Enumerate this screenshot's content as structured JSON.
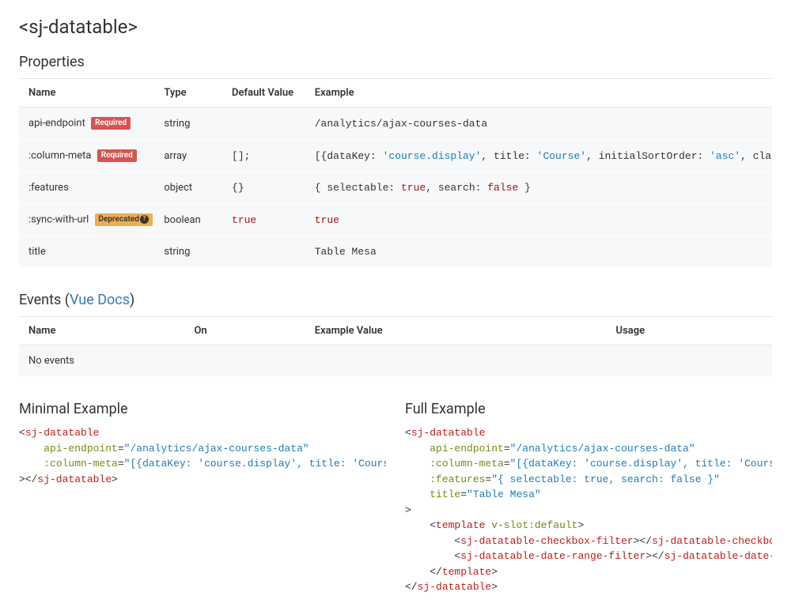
{
  "page_title": "<sj-datatable>",
  "props_section": {
    "title": "Properties",
    "headers": {
      "name": "Name",
      "type": "Type",
      "default": "Default Value",
      "example": "Example"
    },
    "rows": [
      {
        "name": "api-endpoint",
        "required": true,
        "deprecated": false,
        "type": "string",
        "default": "",
        "example": "/analytics/ajax-courses-data"
      },
      {
        "name": ":column-meta",
        "required": true,
        "deprecated": false,
        "type": "array",
        "default": "[];",
        "example": "[{dataKey: 'course.display', title: 'Course', initialSortOrder: 'asc', class: 'text-left', isSortable: true}]"
      },
      {
        "name": ":features",
        "required": false,
        "deprecated": false,
        "type": "object",
        "default": "{}",
        "example": "{ selectable: true, search: false }"
      },
      {
        "name": ":sync-with-url",
        "required": false,
        "deprecated": true,
        "type": "boolean",
        "default": "true",
        "example": "true"
      },
      {
        "name": "title",
        "required": false,
        "deprecated": false,
        "type": "string",
        "default": "",
        "example": "Table Mesa"
      }
    ]
  },
  "badges": {
    "required": "Required",
    "deprecated": "Deprecated"
  },
  "events_section": {
    "title_prefix": "Events (",
    "link_label": "Vue Docs",
    "title_suffix": ")",
    "headers": {
      "name": "Name",
      "on": "On",
      "example": "Example Value",
      "usage": "Usage"
    },
    "empty": "No events"
  },
  "examples": {
    "minimal": {
      "title": "Minimal Example",
      "tag": "sj-datatable",
      "attrs": {
        "api_endpoint": {
          "name": "api-endpoint",
          "value": "/analytics/ajax-courses-data"
        },
        "column_meta": {
          "name": ":column-meta",
          "value": "[{dataKey: 'course.display', title: 'Course', initialSortOrder: 'asc', class: 'text-left', isSortable: true}]"
        }
      }
    },
    "full": {
      "title": "Full Example",
      "tag": "sj-datatable",
      "attrs": {
        "api_endpoint": {
          "name": "api-endpoint",
          "value": "/analytics/ajax-courses-data"
        },
        "column_meta": {
          "name": ":column-meta",
          "value": "[{dataKey: 'course.display', title: 'Course', initialSortOrder: 'asc', class: 'text-left', isSortable: true}]"
        },
        "features": {
          "name": ":features",
          "value": "{ selectable: true, search: false }"
        },
        "title": {
          "name": "title",
          "value": "Table Mesa"
        }
      },
      "slot": {
        "tag": "template",
        "slot_attr": "v-slot:default",
        "children": [
          "sj-datatable-checkbox-filter",
          "sj-datatable-date-range-filter"
        ]
      }
    }
  }
}
